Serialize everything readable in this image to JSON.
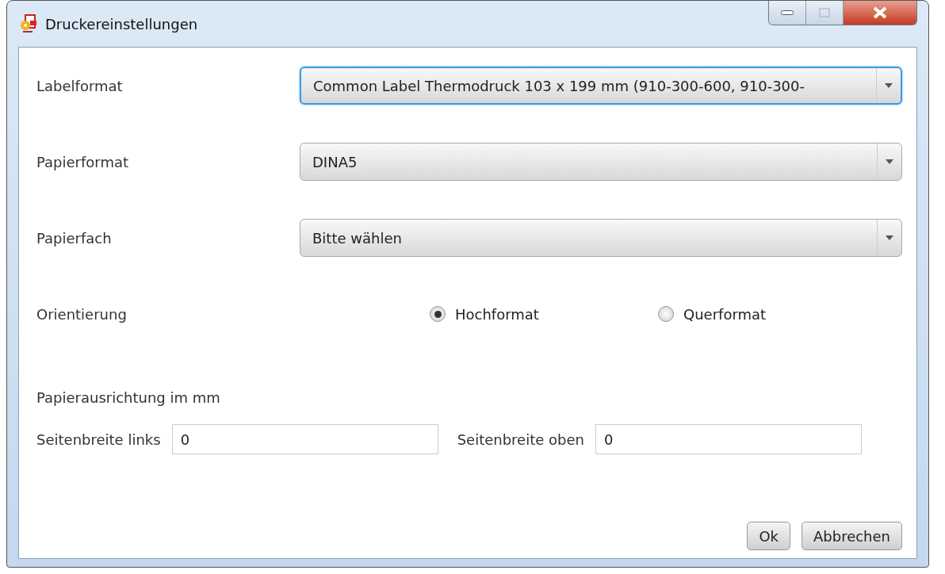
{
  "window": {
    "title": "Druckereinstellungen"
  },
  "rows": [
    {
      "kind": "dropdown",
      "label": "Labelformat",
      "value": "Common Label Thermodruck 103 x 199 mm (910-300-600, 910-300-",
      "focused": true
    },
    {
      "kind": "dropdown",
      "label": "Papierformat",
      "value": "DINA5",
      "focused": false
    },
    {
      "kind": "dropdown",
      "label": "Papierfach",
      "value": "Bitte wählen",
      "focused": false
    },
    {
      "kind": "radio",
      "label": "Orientierung",
      "options": [
        {
          "label": "Hochformat",
          "selected": true
        },
        {
          "label": "Querformat",
          "selected": false
        }
      ]
    },
    {
      "kind": "heading",
      "label": "Papierausrichtung im mm"
    },
    {
      "kind": "inputs",
      "fields": [
        {
          "label": "Seitenbreite links",
          "value": "0"
        },
        {
          "label": "Seitenbreite oben",
          "value": "0"
        }
      ]
    }
  ],
  "buttons": [
    "Ok",
    "Abbrechen"
  ]
}
